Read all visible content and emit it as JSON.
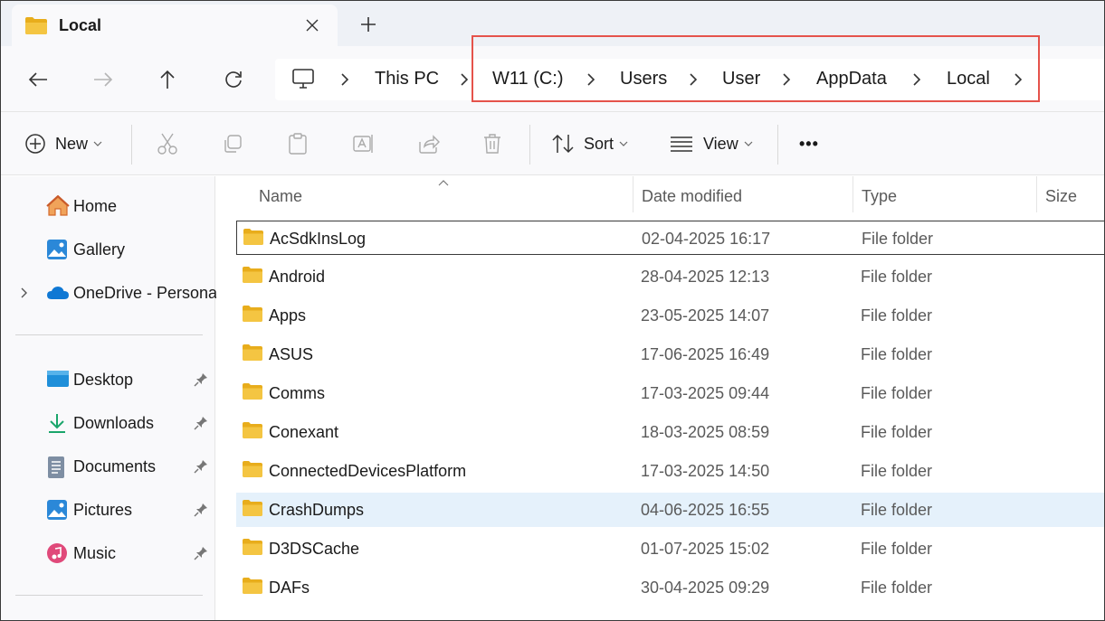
{
  "window": {
    "tab_title": "Local",
    "tab_close_symbol": "✕",
    "new_tab_symbol": "+"
  },
  "address": {
    "crumbs": [
      "This PC",
      "W11 (C:)",
      "Users",
      "User",
      "AppData",
      "Local"
    ],
    "highlight_color": "#e5534b"
  },
  "toolbar": {
    "new_label": "New",
    "sort_label": "Sort",
    "view_label": "View",
    "more_label": "•••"
  },
  "sidebar": {
    "items": [
      {
        "label": "Home",
        "icon": "home-icon"
      },
      {
        "label": "Gallery",
        "icon": "gallery-icon"
      },
      {
        "label": "OneDrive - Persona",
        "icon": "onedrive-icon"
      },
      {
        "label": "Desktop",
        "icon": "desktop-icon"
      },
      {
        "label": "Downloads",
        "icon": "downloads-icon"
      },
      {
        "label": "Documents",
        "icon": "documents-icon"
      },
      {
        "label": "Pictures",
        "icon": "pictures-icon"
      },
      {
        "label": "Music",
        "icon": "music-icon"
      }
    ]
  },
  "columns": {
    "name": "Name",
    "date": "Date modified",
    "type": "Type",
    "size": "Size"
  },
  "files": [
    {
      "name": "AcSdkInsLog",
      "date": "02-04-2025 16:17",
      "type": "File folder"
    },
    {
      "name": "Android",
      "date": "28-04-2025 12:13",
      "type": "File folder"
    },
    {
      "name": "Apps",
      "date": "23-05-2025 14:07",
      "type": "File folder"
    },
    {
      "name": "ASUS",
      "date": "17-06-2025 16:49",
      "type": "File folder"
    },
    {
      "name": "Comms",
      "date": "17-03-2025 09:44",
      "type": "File folder"
    },
    {
      "name": "Conexant",
      "date": "18-03-2025 08:59",
      "type": "File folder"
    },
    {
      "name": "ConnectedDevicesPlatform",
      "date": "17-03-2025 14:50",
      "type": "File folder"
    },
    {
      "name": "CrashDumps",
      "date": "04-06-2025 16:55",
      "type": "File folder"
    },
    {
      "name": "D3DSCache",
      "date": "01-07-2025 15:02",
      "type": "File folder"
    },
    {
      "name": "DAFs",
      "date": "30-04-2025 09:29",
      "type": "File folder"
    }
  ],
  "colors": {
    "folder": "#f4c542",
    "folder_dark": "#e8ad1c",
    "hover_row": "#e5f1fb",
    "accent": "#0067c0"
  }
}
